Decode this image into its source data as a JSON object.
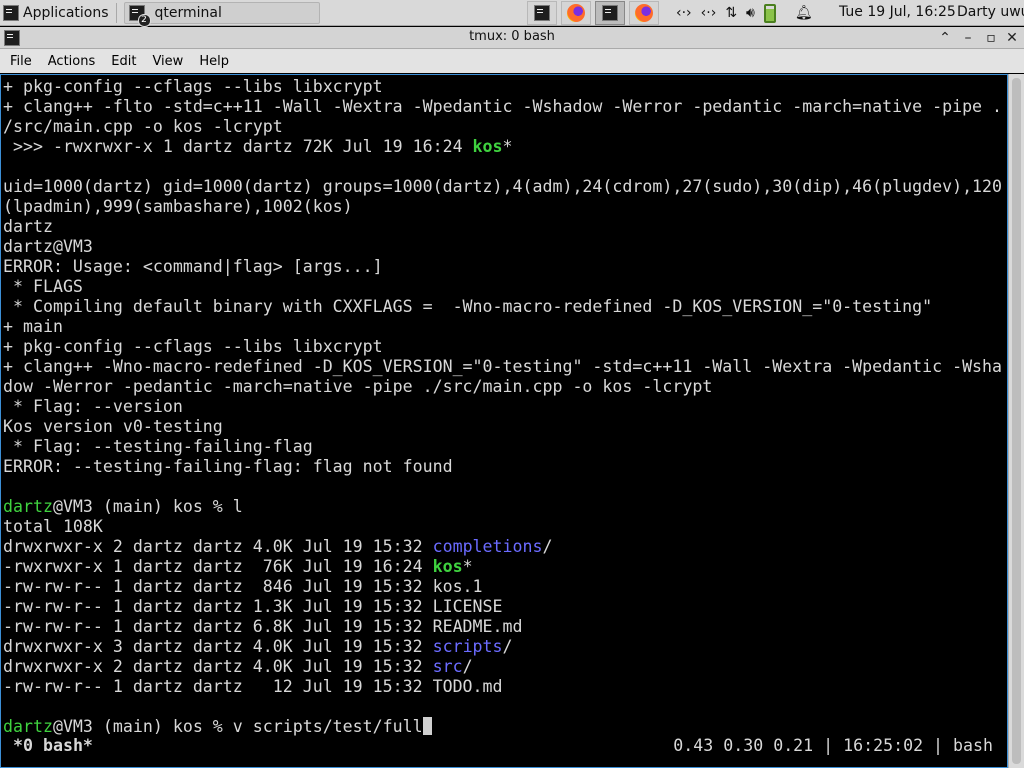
{
  "panel": {
    "apps_label": "Applications",
    "task": {
      "title": "qterminal",
      "badge": "2"
    },
    "tray_items": [
      {
        "icon": "terminal-icon",
        "active": false
      },
      {
        "icon": "firefox-icon",
        "active": false
      },
      {
        "icon": "terminal-icon",
        "active": true
      },
      {
        "icon": "firefox-icon",
        "active": false
      }
    ],
    "clock": "Tue 19 Jul, 16:25",
    "user": "Darty uwu"
  },
  "window": {
    "title": "tmux: 0 bash"
  },
  "menu": [
    "File",
    "Actions",
    "Edit",
    "View",
    "Help"
  ],
  "terminal": {
    "lines": [
      [
        {
          "t": "+ pkg-config --cflags --libs libxcrypt"
        }
      ],
      [
        {
          "t": "+ clang++ -flto -std=c++11 -Wall -Wextra -Wpedantic -Wshadow -Werror -pedantic -march=native -pipe ."
        }
      ],
      [
        {
          "t": "/src/main.cpp -o kos -lcrypt"
        }
      ],
      [
        {
          "t": " >>> -rwxrwxr-x 1 dartz dartz 72K Jul 19 16:24 "
        },
        {
          "t": "kos",
          "c": "gb"
        },
        {
          "t": "*"
        }
      ],
      [
        {
          "t": ""
        }
      ],
      [
        {
          "t": "uid=1000(dartz) gid=1000(dartz) groups=1000(dartz),4(adm),24(cdrom),27(sudo),30(dip),46(plugdev),120"
        }
      ],
      [
        {
          "t": "(lpadmin),999(sambashare),1002(kos)"
        }
      ],
      [
        {
          "t": "dartz"
        }
      ],
      [
        {
          "t": "dartz@VM3"
        }
      ],
      [
        {
          "t": "ERROR: Usage: <command|flag> [args...]"
        }
      ],
      [
        {
          "t": " * FLAGS"
        }
      ],
      [
        {
          "t": " * Compiling default binary with CXXFLAGS =  -Wno-macro-redefined -D_KOS_VERSION_=\"0-testing\""
        }
      ],
      [
        {
          "t": "+ main"
        }
      ],
      [
        {
          "t": "+ pkg-config --cflags --libs libxcrypt"
        }
      ],
      [
        {
          "t": "+ clang++ -Wno-macro-redefined -D_KOS_VERSION_=\"0-testing\" -std=c++11 -Wall -Wextra -Wpedantic -Wsha"
        }
      ],
      [
        {
          "t": "dow -Werror -pedantic -march=native -pipe ./src/main.cpp -o kos -lcrypt"
        }
      ],
      [
        {
          "t": " * Flag: --version"
        }
      ],
      [
        {
          "t": "Kos version v0-testing"
        }
      ],
      [
        {
          "t": " * Flag: --testing-failing-flag"
        }
      ],
      [
        {
          "t": "ERROR: --testing-failing-flag: flag not found"
        }
      ],
      [
        {
          "t": ""
        }
      ],
      [
        {
          "t": "dartz",
          "c": "g"
        },
        {
          "t": "@VM3 (main) kos % l"
        }
      ],
      [
        {
          "t": "total 108K"
        }
      ],
      [
        {
          "t": "drwxrwxr-x 2 dartz dartz 4.0K Jul 19 15:32 "
        },
        {
          "t": "completions",
          "c": "b"
        },
        {
          "t": "/"
        }
      ],
      [
        {
          "t": "-rwxrwxr-x 1 dartz dartz  76K Jul 19 16:24 "
        },
        {
          "t": "kos",
          "c": "gb"
        },
        {
          "t": "*"
        }
      ],
      [
        {
          "t": "-rw-rw-r-- 1 dartz dartz  846 Jul 19 15:32 kos.1"
        }
      ],
      [
        {
          "t": "-rw-rw-r-- 1 dartz dartz 1.3K Jul 19 15:32 LICENSE"
        }
      ],
      [
        {
          "t": "-rw-rw-r-- 1 dartz dartz 6.8K Jul 19 15:32 README.md"
        }
      ],
      [
        {
          "t": "drwxrwxr-x 3 dartz dartz 4.0K Jul 19 15:32 "
        },
        {
          "t": "scripts",
          "c": "b"
        },
        {
          "t": "/"
        }
      ],
      [
        {
          "t": "drwxrwxr-x 2 dartz dartz 4.0K Jul 19 15:32 "
        },
        {
          "t": "src",
          "c": "b"
        },
        {
          "t": "/"
        }
      ],
      [
        {
          "t": "-rw-rw-r-- 1 dartz dartz   12 Jul 19 15:32 TODO.md"
        }
      ],
      [
        {
          "t": ""
        }
      ],
      [
        {
          "t": "dartz",
          "c": "g"
        },
        {
          "t": "@VM3 (main) kos % v scripts/test/full"
        },
        {
          "cursor": true
        }
      ]
    ],
    "status": {
      "window": "*0 bash*",
      "right": "0.43 0.30 0.21 | 16:25:02 | bash"
    }
  },
  "colors": {
    "prompt_green": "#3fd23f",
    "dir_blue": "#6b6bff",
    "focus_border": "#3c8fd6"
  }
}
